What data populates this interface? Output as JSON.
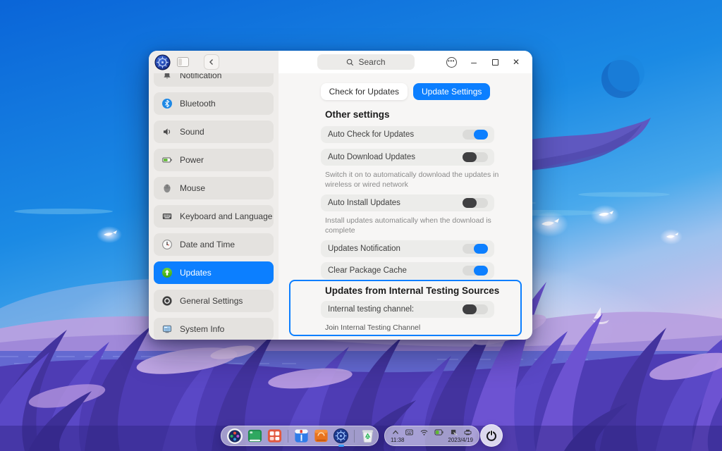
{
  "colors": {
    "accent": "#0C7FFF",
    "selected_nav": "#0C7FFF",
    "toggle_off_knob": "#3F3F41"
  },
  "window": {
    "titlebar": {
      "search_label": "Search"
    },
    "sidebar": {
      "items": [
        {
          "label": "Notification",
          "selected": false
        },
        {
          "label": "Bluetooth",
          "selected": false
        },
        {
          "label": "Sound",
          "selected": false
        },
        {
          "label": "Power",
          "selected": false
        },
        {
          "label": "Mouse",
          "selected": false
        },
        {
          "label": "Keyboard and Language",
          "selected": false
        },
        {
          "label": "Date and Time",
          "selected": false
        },
        {
          "label": "Updates",
          "selected": true
        },
        {
          "label": "General Settings",
          "selected": false
        },
        {
          "label": "System Info",
          "selected": false
        }
      ]
    },
    "content": {
      "tabs": [
        {
          "label": "Check for Updates",
          "active": false
        },
        {
          "label": "Update Settings",
          "active": true
        }
      ],
      "section_title": "Other settings",
      "rows": [
        {
          "label": "Auto Check for Updates",
          "toggle": "on"
        },
        {
          "label": "Auto Download Updates",
          "toggle": "off",
          "description": "Switch it on to automatically download the updates in wireless or wired network"
        },
        {
          "label": "Auto Install Updates",
          "toggle": "off",
          "description": "Install updates automatically when the download is complete"
        },
        {
          "label": "Updates Notification",
          "toggle": "on"
        },
        {
          "label": "Clear Package Cache",
          "toggle": "on"
        }
      ],
      "testing_section": {
        "title": "Updates from Internal Testing Sources",
        "row": {
          "label": "Internal testing channel:",
          "toggle": "off"
        },
        "link": "Join Internal Testing Channel"
      }
    }
  },
  "dock": {
    "apps": [
      {
        "name": "launcher"
      },
      {
        "name": "terminal"
      },
      {
        "name": "app-grid"
      },
      {
        "name": "text-editor"
      },
      {
        "name": "app-store"
      },
      {
        "name": "control-center",
        "running": true
      },
      {
        "name": "trash"
      }
    ],
    "tray": {
      "time": "11:38",
      "date": "2023/4/19"
    }
  }
}
